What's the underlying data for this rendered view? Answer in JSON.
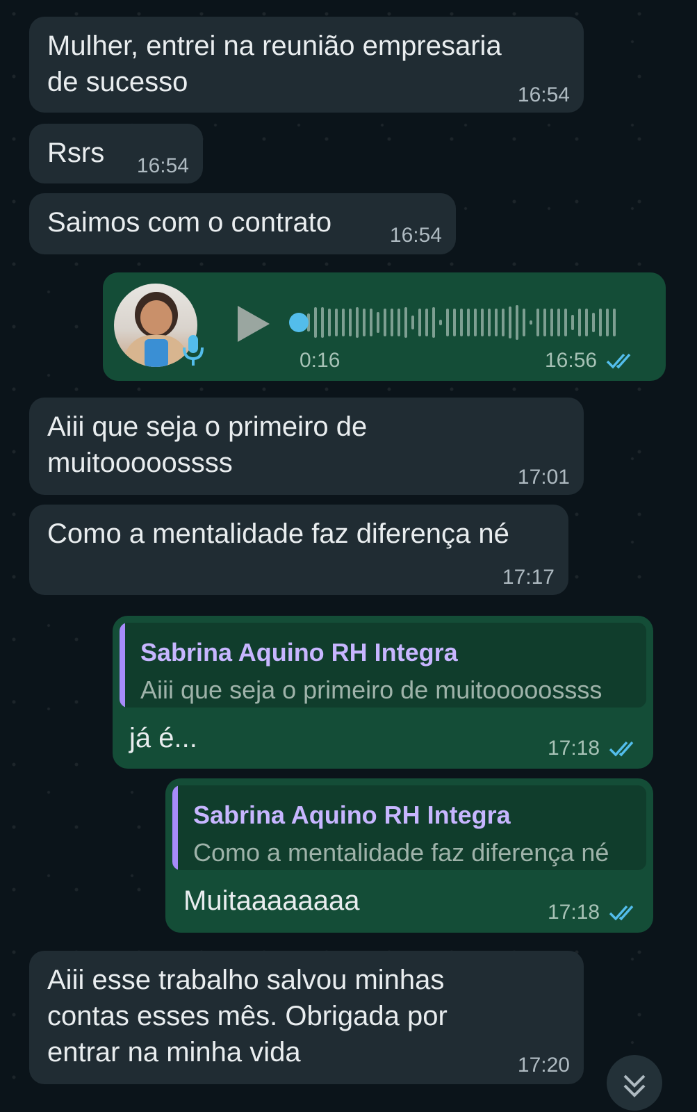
{
  "messages": {
    "m1": {
      "text": "Mulher, entrei na reunião empresaria\nde sucesso",
      "time": "16:54"
    },
    "m2": {
      "text": "Rsrs",
      "time": "16:54"
    },
    "m3": {
      "text": "Saimos com o contrato",
      "time": "16:54"
    },
    "voice": {
      "duration": "0:16",
      "time": "16:56",
      "progress": 0.0
    },
    "m5": {
      "text": "Aiii que seja o primeiro de\nmuitooooossss",
      "time": "17:01"
    },
    "m6": {
      "text": "Como a mentalidade faz diferença né",
      "time": "17:17"
    },
    "r1": {
      "quote_name": "Sabrina Aquino RH Integra",
      "quote_text": "Aiii que seja o primeiro de muitooooossss",
      "text": "já é...",
      "time": "17:18"
    },
    "r2": {
      "quote_name": "Sabrina Aquino RH Integra",
      "quote_text": "Como a mentalidade faz diferença né",
      "text": "Muitaaaaaaaa",
      "time": "17:18"
    },
    "m9": {
      "text": "Aiii esse trabalho salvou minhas\ncontas esses mês. Obrigada por\nentrar na minha vida",
      "time": "17:20"
    }
  },
  "icons": {
    "play": "play-icon",
    "mic": "microphone-icon",
    "read": "double-check-icon",
    "scroll": "chevron-down-icon"
  },
  "colors": {
    "incoming": "#202c33",
    "outgoing": "#144d37",
    "read_ticks": "#53bdeb",
    "quote_accent": "#a78bfa"
  }
}
